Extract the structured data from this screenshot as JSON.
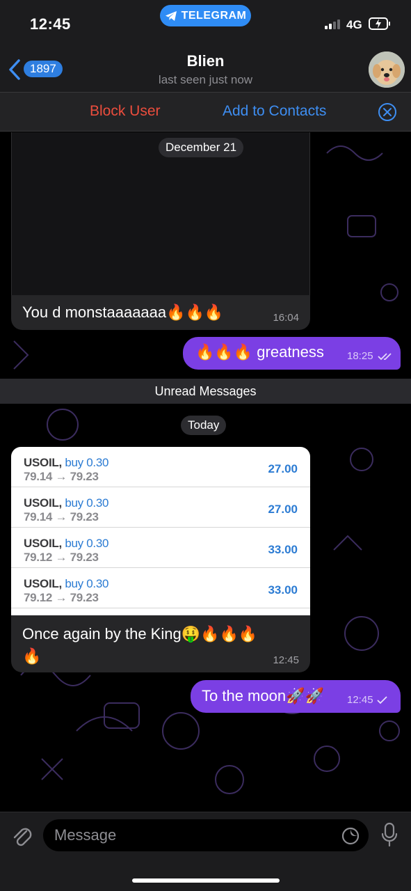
{
  "status_bar": {
    "time": "12:45",
    "app_pill": "TELEGRAM",
    "network": "4G"
  },
  "header": {
    "back_count": "1897",
    "name": "Blien",
    "status": "last seen just now"
  },
  "actions": {
    "block": "Block User",
    "add": "Add to Contacts"
  },
  "dates": {
    "first": "December 21",
    "second": "Today"
  },
  "unread_banner": "Unread Messages",
  "messages": [
    {
      "text": "You d monstaaaaaaa🔥🔥🔥",
      "time": "16:04"
    },
    {
      "text": "🔥🔥🔥 greatness",
      "time": "18:25"
    },
    {
      "text": "Once again by the King🤑🔥🔥🔥",
      "text2": "🔥",
      "time": "12:45"
    },
    {
      "text": "To the moon🚀🚀",
      "time": "12:45"
    }
  ],
  "trades": [
    {
      "symbol": "USOIL,",
      "side": "buy 0.30",
      "prices": "79.14 → 79.23",
      "profit": "27.00"
    },
    {
      "symbol": "USOIL,",
      "side": "buy 0.30",
      "prices": "79.14 → 79.23",
      "profit": "27.00"
    },
    {
      "symbol": "USOIL,",
      "side": "buy 0.30",
      "prices": "79.12 → 79.23",
      "profit": "33.00"
    },
    {
      "symbol": "USOIL,",
      "side": "buy 0.30",
      "prices": "79.12 → 79.23",
      "profit": "33.00"
    }
  ],
  "input": {
    "placeholder": "Message"
  },
  "colors": {
    "accent": "#3e8ef2",
    "outgoing": "#7b3fe4",
    "danger": "#eb4d3d",
    "incoming": "#262628"
  },
  "icons": [
    "telegram-icon",
    "back-chevron-icon",
    "close-circle-icon",
    "double-check-icon",
    "single-check-icon",
    "paperclip-icon",
    "sticker-icon",
    "microphone-icon"
  ]
}
